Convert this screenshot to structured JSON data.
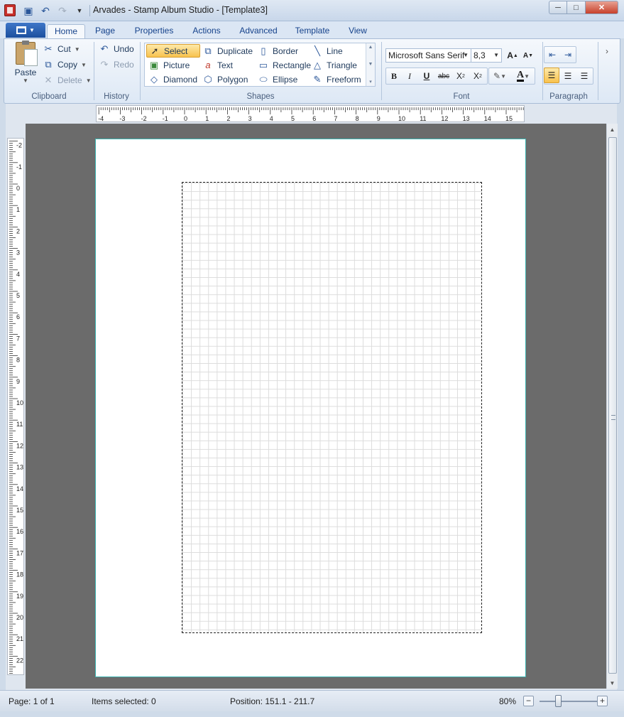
{
  "window": {
    "title": "Arvades - Stamp Album Studio - [Template3]",
    "controls": {
      "minimize": "─",
      "maximize": "□",
      "close": "✕"
    }
  },
  "quick_access": {
    "save_icon": "save-icon",
    "undo_icon": "undo-icon",
    "redo_icon": "redo-icon",
    "customize_icon": "customize-dropdown-icon"
  },
  "ribbon": {
    "tabs": [
      {
        "label": "Home",
        "active": true
      },
      {
        "label": "Page"
      },
      {
        "label": "Properties"
      },
      {
        "label": "Actions"
      },
      {
        "label": "Advanced"
      },
      {
        "label": "Template"
      },
      {
        "label": "View"
      }
    ],
    "clipboard": {
      "group_label": "Clipboard",
      "paste": "Paste",
      "cut": "Cut",
      "copy": "Copy",
      "delete": "Delete"
    },
    "history": {
      "group_label": "History",
      "undo": "Undo",
      "redo": "Redo"
    },
    "shapes": {
      "group_label": "Shapes",
      "items": [
        {
          "label": "Select",
          "icon": "pointer-icon",
          "selected": true
        },
        {
          "label": "Duplicate",
          "icon": "duplicate-icon"
        },
        {
          "label": "Border",
          "icon": "border-icon"
        },
        {
          "label": "Line",
          "icon": "line-icon"
        },
        {
          "label": "Picture",
          "icon": "picture-icon"
        },
        {
          "label": "Text",
          "icon": "text-icon"
        },
        {
          "label": "Rectangle",
          "icon": "rectangle-icon"
        },
        {
          "label": "Triangle",
          "icon": "triangle-icon"
        },
        {
          "label": "Diamond",
          "icon": "diamond-icon"
        },
        {
          "label": "Polygon",
          "icon": "polygon-icon"
        },
        {
          "label": "Ellipse",
          "icon": "ellipse-icon"
        },
        {
          "label": "Freeform",
          "icon": "freeform-icon"
        }
      ]
    },
    "font": {
      "group_label": "Font",
      "family": "Microsoft Sans Serif",
      "size": "8,3",
      "grow": "A",
      "shrink": "A",
      "bold": "B",
      "italic": "I",
      "underline": "U",
      "strikethrough": "abc",
      "subscript": "X",
      "superscript": "X",
      "highlight_icon": "highlight-pen-icon",
      "font_color": "A",
      "font_color_hex": "#000000"
    },
    "paragraph": {
      "group_label": "Paragraph",
      "align_active": "left"
    }
  },
  "rulers": {
    "horizontal_labels": [
      "-4",
      "-3",
      "-2",
      "-1",
      "0",
      "1",
      "2",
      "3",
      "4",
      "5",
      "6",
      "7",
      "8",
      "9",
      "10",
      "11",
      "12",
      "13",
      "14",
      "15"
    ],
    "vertical_labels": [
      "-2",
      "-1",
      "0",
      "1",
      "2",
      "3",
      "4",
      "5",
      "6",
      "7",
      "8",
      "9",
      "10",
      "11",
      "12",
      "13",
      "14",
      "15",
      "16",
      "17",
      "18",
      "19",
      "20",
      "21",
      "22"
    ]
  },
  "status": {
    "page": "Page: 1 of 1",
    "items_selected": "Items selected: 0",
    "position": "Position: 151.1 - 211.7",
    "zoom": "80%",
    "zoom_minus": "−",
    "zoom_plus": "+"
  },
  "colors": {
    "page_border": "#3bb3b0",
    "canvas_bg": "#6b6b6b",
    "selected_tool": "#f8c24e",
    "app_menu": "#1c4f9e"
  }
}
